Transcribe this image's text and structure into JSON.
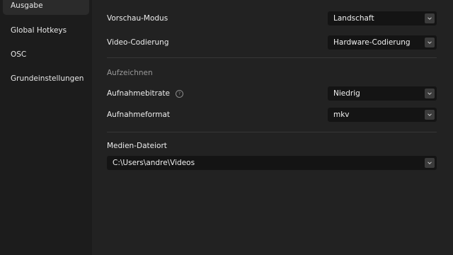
{
  "sidebar": {
    "items": [
      {
        "label": "Ausgabe",
        "active": true
      },
      {
        "label": "Global Hotkeys",
        "active": false
      },
      {
        "label": "OSC",
        "active": false
      },
      {
        "label": "Grundeinstellungen",
        "active": false
      }
    ]
  },
  "settings": {
    "preview_mode": {
      "label": "Vorschau-Modus",
      "value": "Landschaft"
    },
    "video_encoding": {
      "label": "Video-Codierung",
      "value": "Hardware-Codierung"
    },
    "recording_section": "Aufzeichnen",
    "bitrate": {
      "label": "Aufnahmebitrate",
      "value": "Niedrig",
      "help_icon": "?"
    },
    "format": {
      "label": "Aufnahmeformat",
      "value": "mkv"
    },
    "media_location": {
      "label": "Medien-Dateiort",
      "value": "C:\\Users\\andre\\Videos"
    }
  },
  "icons": {
    "dropdown": "chevron-down-icon",
    "help": "help-circle-icon"
  },
  "colors": {
    "sidebar_bg": "#1c1c1c",
    "main_bg": "#222222",
    "field_bg": "#141414",
    "active_item": "#2b2b2b"
  }
}
